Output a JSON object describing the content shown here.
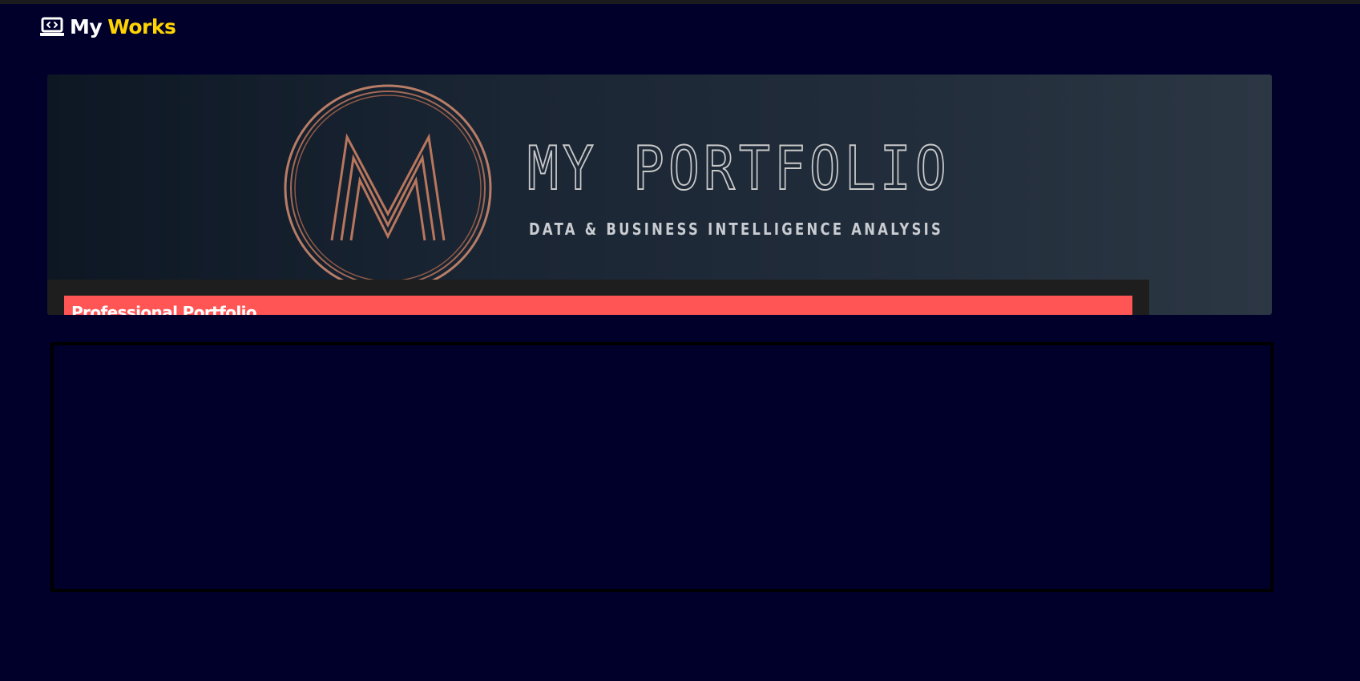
{
  "section": {
    "icon": "laptop-code-icon",
    "title_part1": "My",
    "title_part2": "Works",
    "accent_color": "#ffd400"
  },
  "card": {
    "banner": {
      "logo": "monogram-m-logo",
      "logo_letter": "M",
      "title": "MY PORTFOLIO",
      "subtitle": "DATA & BUSINESS INTELLIGENCE ANALYSIS"
    },
    "caption": "Professional Portfolio",
    "caption_color": "#ff5555"
  },
  "colors": {
    "page_background": "#00002b",
    "caption_bar": "#1e1e1e",
    "frame_border": "#000000"
  }
}
